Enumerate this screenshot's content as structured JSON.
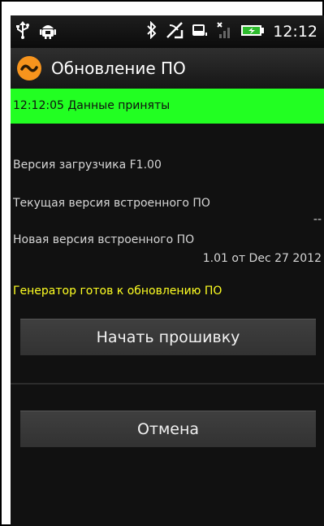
{
  "status_bar": {
    "time": "12:12",
    "left_icons": [
      "usb-icon",
      "android-debug-icon"
    ],
    "right_icons": [
      "bluetooth-icon",
      "signal-off-icon",
      "storage-icon",
      "no-signal-icon",
      "battery-charging-icon"
    ]
  },
  "action_bar": {
    "title": "Обновление ПО",
    "logo_icon": "app-logo-icon",
    "logo_color": "#f7941d"
  },
  "banner": {
    "text": "12:12:05 Данные приняты",
    "color": "#22ff22"
  },
  "info": {
    "bootloader_label": "Версия загрузчика F1.00",
    "current_fw_label": "Текущая версия встроенного ПО",
    "current_fw_value": "--",
    "new_fw_label": "Новая версия встроенного ПО",
    "new_fw_value": "1.01 от Dec 27 2012"
  },
  "ready_message": {
    "text": "Генератор готов к обновлению ПО",
    "color": "#ffff22"
  },
  "buttons": {
    "start_label": "Начать прошивку",
    "cancel_label": "Отмена"
  }
}
